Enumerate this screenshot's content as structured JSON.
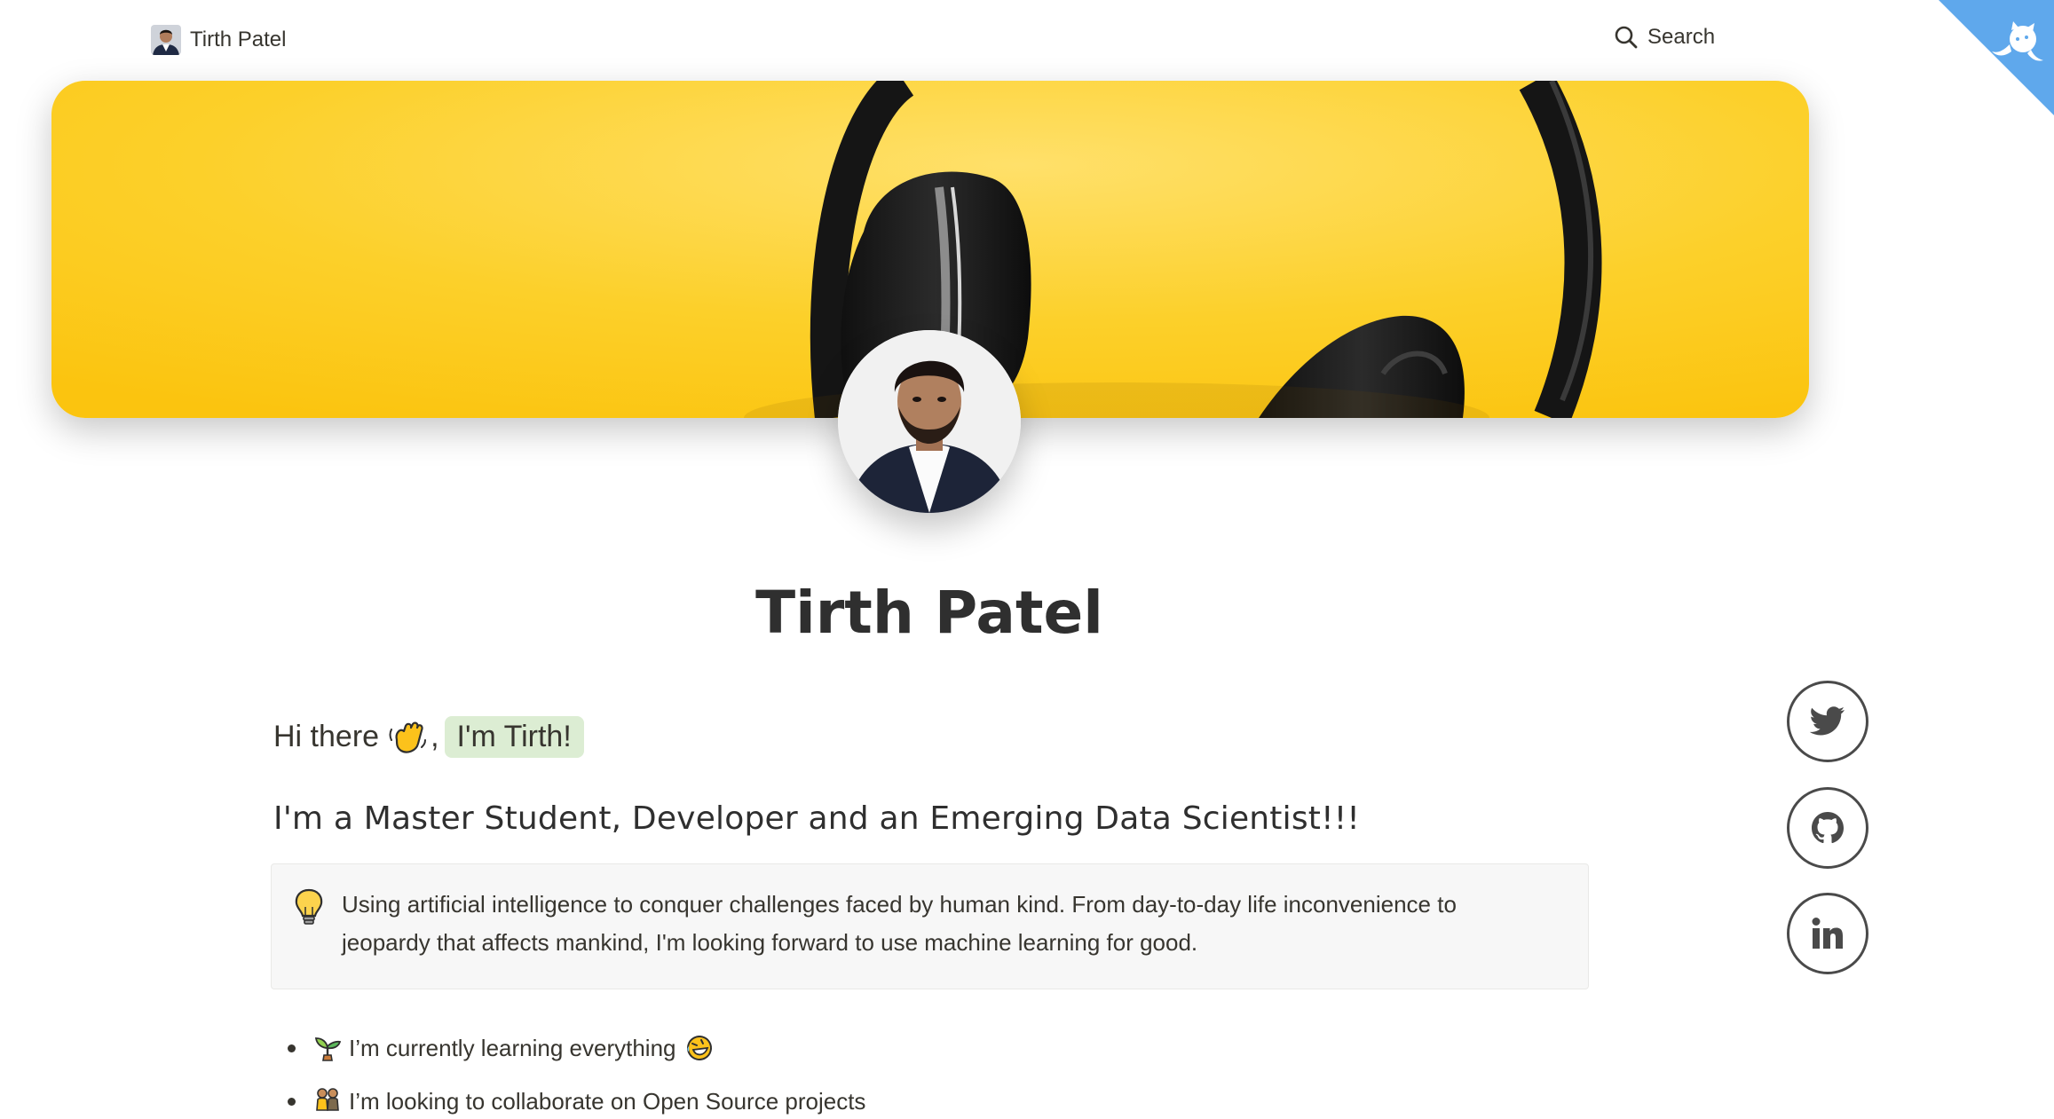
{
  "nav": {
    "site_name": "Tirth Patel",
    "search_label": "Search",
    "brand_icon": "avatar",
    "search_icon": "magnifier",
    "corner_icon": "github-octocat"
  },
  "profile": {
    "name": "Tirth Patel"
  },
  "intro": {
    "greeting": "Hi there",
    "comma": ",",
    "highlight": "I'm Tirth!"
  },
  "tagline": "I'm a Master Student, Developer and an Emerging Data Scientist!!!",
  "callout": {
    "icon": "lightbulb",
    "text": "Using artificial intelligence to conquer challenges faced by human kind. From day-to-day life inconvenience to jeopardy that affects mankind, I'm looking forward to use machine learning for good."
  },
  "bullets": [
    {
      "icon": "seedling",
      "text": "I’m currently learning everything",
      "trailing_icon": "rofl-face"
    },
    {
      "icon": "people-holding-hands",
      "text": "I’m looking to collaborate on Open Source projects"
    }
  ],
  "social": [
    {
      "name": "twitter",
      "icon": "twitter-bird"
    },
    {
      "name": "github",
      "icon": "github-octocat"
    },
    {
      "name": "linkedin",
      "icon": "linkedin-logo"
    }
  ],
  "colors": {
    "cover_yellow": "#fcc81a",
    "highlight_green": "#dcedd3",
    "ribbon_blue": "#5fa8ec",
    "text": "#37352f"
  }
}
